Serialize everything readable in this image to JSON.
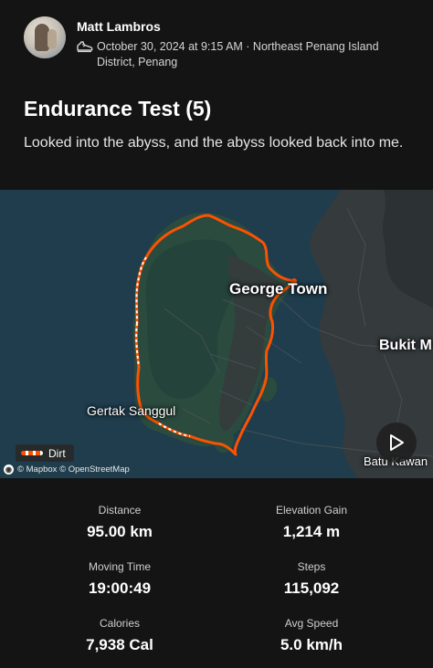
{
  "activity": {
    "athlete_name": "Matt Lambros",
    "meta": "October 30, 2024 at 9:15 AM · Northeast Penang Island District, Penang",
    "title": "Endurance Test (5)",
    "description": "Looked into the abyss, and the abyss looked back into me.",
    "activity_icon": "shoe-icon"
  },
  "map": {
    "labels": {
      "george_town": "George Town",
      "bukit": "Bukit M",
      "gertak": "Gertak Sanggul",
      "batu": "Batu Kawan"
    },
    "legend_label": "Dirt",
    "attribution": "© Mapbox © OpenStreetMap",
    "route_color": "#fc5200",
    "play_icon": "play-icon"
  },
  "stats": [
    {
      "label": "Distance",
      "value": "95.00 km"
    },
    {
      "label": "Elevation Gain",
      "value": "1,214 m"
    },
    {
      "label": "Moving Time",
      "value": "19:00:49"
    },
    {
      "label": "Steps",
      "value": "115,092"
    },
    {
      "label": "Calories",
      "value": "7,938 Cal"
    },
    {
      "label": "Avg Speed",
      "value": "5.0 km/h"
    }
  ]
}
